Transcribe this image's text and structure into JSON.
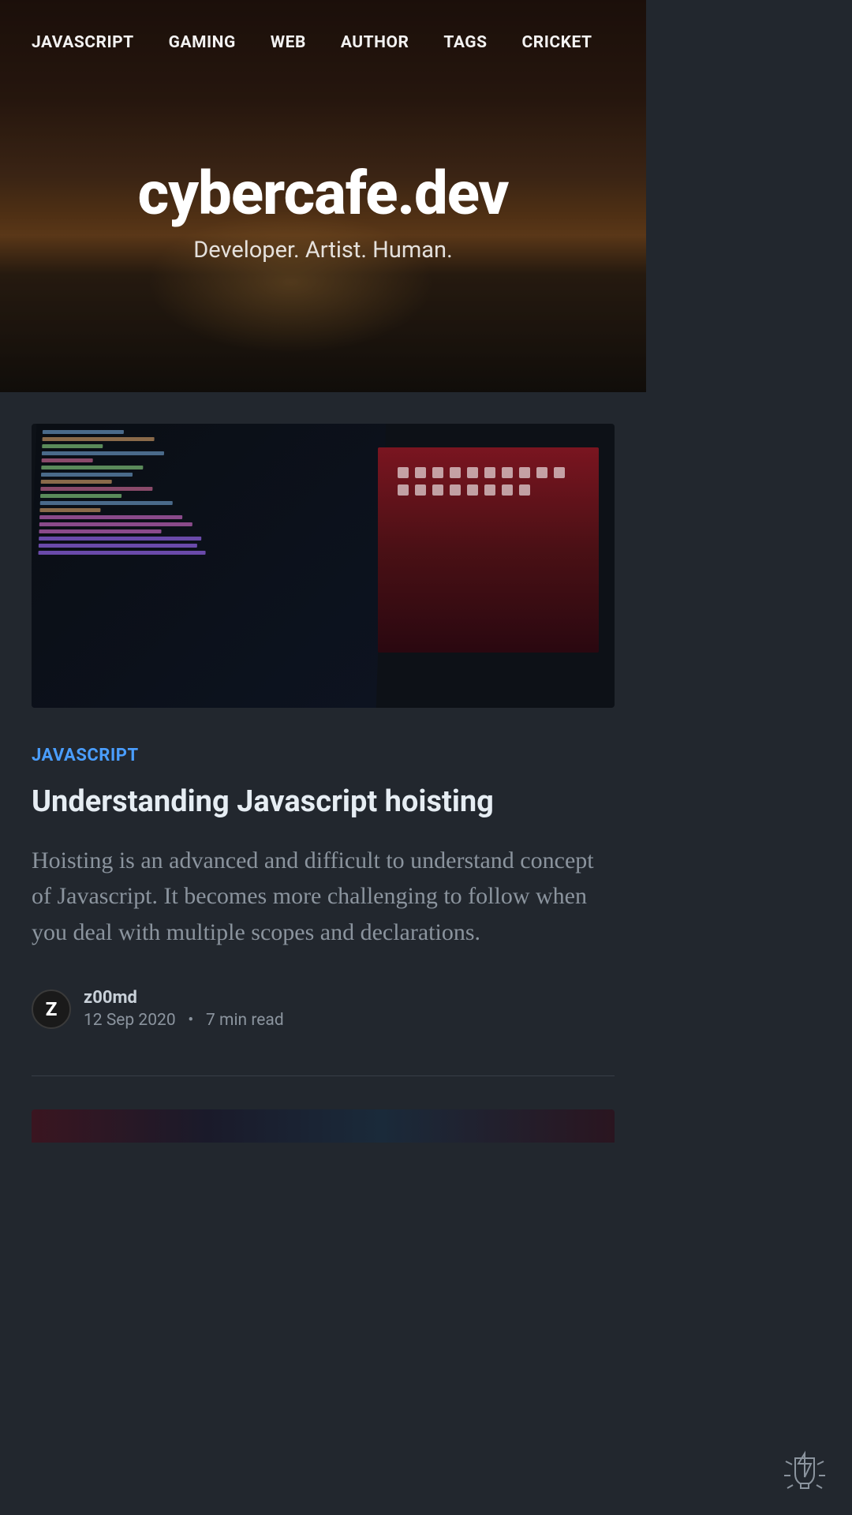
{
  "nav": {
    "items": [
      "JAVASCRIPT",
      "GAMING",
      "WEB",
      "AUTHOR",
      "TAGS",
      "CRICKET"
    ]
  },
  "site": {
    "title": "cybercafe.dev",
    "description": "Developer. Artist. Human."
  },
  "post": {
    "tag": "JAVASCRIPT",
    "title": "Understanding Javascript hoisting",
    "excerpt": "Hoisting is an advanced and difficult to understand concept of Javascript. It becomes more challenging to follow when you deal with multiple scopes and declarations.",
    "author": "z00md",
    "avatar_letter": "Z",
    "date": "12 Sep 2020",
    "read_time": "7 min read",
    "separator": "•"
  }
}
